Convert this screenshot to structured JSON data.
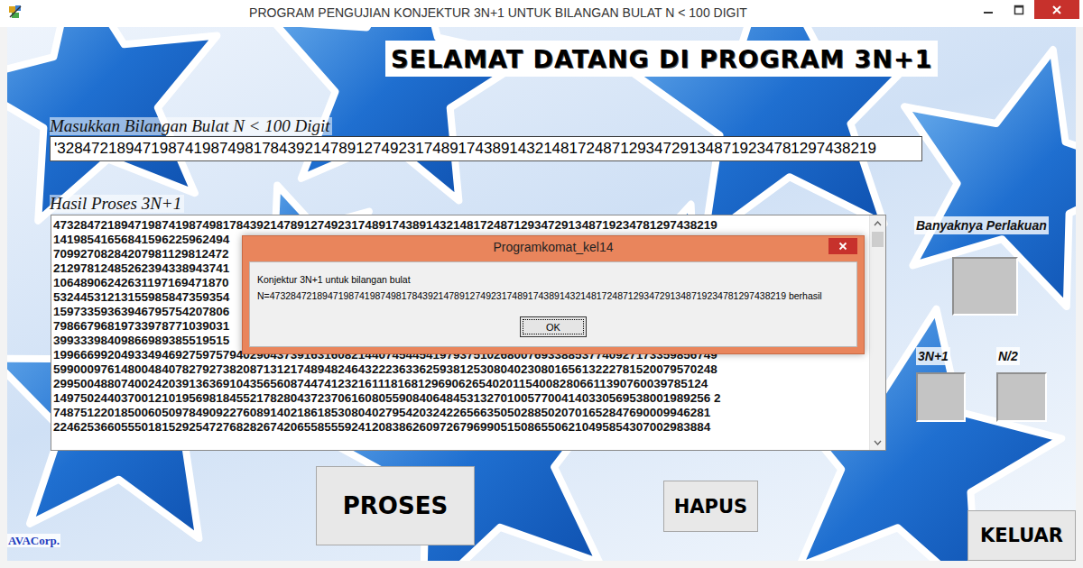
{
  "window": {
    "title": "PROGRAM PENGUJIAN KONJEKTUR 3N+1 UNTUK BILANGAN BULAT N < 100 DIGIT"
  },
  "heading": "SELAMAT DATANG DI PROGRAM 3N+1",
  "input": {
    "label": "Masukkan Bilangan Bulat N < 100 Digit",
    "value": "'328472189471987419874981784392147891274923174891743891432148172487129347291348719234781297438219"
  },
  "result": {
    "label": "Hasil Proses 3N+1",
    "lines": [
      "47328472189471987419874981784392147891274923174891743891432148172487129347291348719234781297438219",
      "14198541656841596225962494",
      "70992708284207981129812472",
      "21297812485262394338943741",
      "10648906242631197169471870",
      "53244531213155985847359354",
      "15973359363946795754207806",
      "79866796819733978771039031",
      "39933398409866989385519515",
      "19966699204933494692759757940290437391631608214407454454197937510268007693388537740927173359856749",
      "59900097614800484078279273820871312174894824643222363362593812530804023080165613222781520079570248",
      "2995004880740024203913636910435656087447412321611181681296906265402011540082806611390760039785124",
      "1497502440370012101956981845521782804372370616080559084064845313270100577004140330569538001989256 2",
      "7487512201850060509784909227608914021861853080402795420324226566350502885020701652847690009946281",
      "2246253660555018152925472768282674206558555924120838626097267969905150865506210495854307002983884"
    ]
  },
  "counters": {
    "total_label": "Banyaknya Perlakuan",
    "odd_label": "3N+1",
    "even_label": "N/2"
  },
  "buttons": [
    "PROSES",
    "HAPUS",
    "KELUAR"
  ],
  "brand": "AVACorp.",
  "dialog": {
    "title": "Programkomat_kel14",
    "message": [
      "Konjektur 3N+1 untuk bilangan bulat",
      "N=47328472189471987419874981784392147891274923174891743891432148172487129347291348719234781297438219 berhasil"
    ],
    "button": "OK"
  }
}
